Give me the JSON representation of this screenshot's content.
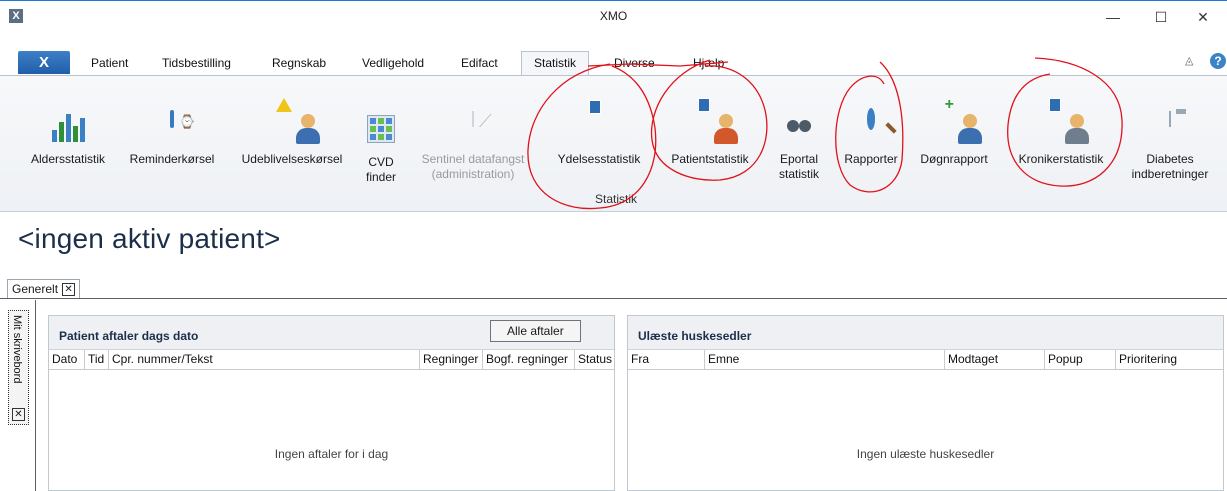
{
  "window": {
    "app_icon": "X",
    "title": "XMO",
    "minimize_glyph": "—",
    "maximize_glyph": "☐",
    "close_glyph": "✕"
  },
  "menu": {
    "app_button": "X",
    "tabs": [
      "Patient",
      "Tidsbestilling",
      "Regnskab",
      "Vedligehold",
      "Edifact",
      "Statistik",
      "Diverse",
      "Hjælp"
    ],
    "active_tab": "Statistik",
    "collapse_glyph": "◬",
    "help_glyph": "?"
  },
  "ribbon": {
    "buttons": [
      {
        "label": "Aldersstatistik",
        "icon": "bar-chart-icon",
        "enabled": true
      },
      {
        "label": "Reminderkørsel",
        "icon": "clock-icon",
        "enabled": true
      },
      {
        "label": "Udeblivelseskørsel",
        "icon": "person-warning-icon",
        "enabled": true
      },
      {
        "label": "CVD finder",
        "icon": "grid-icon",
        "enabled": true
      },
      {
        "label": "Sentinel datafangst (administration)",
        "icon": "chart-disabled-icon",
        "enabled": false
      },
      {
        "label": "Ydelsesstatistik",
        "icon": "sheet-calculator-icon",
        "enabled": true
      },
      {
        "label": "Patientstatistik",
        "icon": "people-calculator-icon",
        "enabled": true
      },
      {
        "label": "Eportal statistik",
        "icon": "binoculars-icon",
        "enabled": true
      },
      {
        "label": "Rapporter",
        "icon": "magnifier-icon",
        "enabled": true
      },
      {
        "label": "Døgnrapport",
        "icon": "person-add-icon",
        "enabled": true
      },
      {
        "label": "Kronikerstatistik",
        "icon": "person-calculator-icon",
        "enabled": true
      },
      {
        "label": "Diabetes indberetninger",
        "icon": "clipboard-icon",
        "enabled": true
      }
    ],
    "group_label": "Statistik"
  },
  "patient": {
    "title": "<ingen aktiv patient>"
  },
  "workspace": {
    "tab_label": "Generelt",
    "close_glyph": "✕",
    "side_label": "Mit skrivebord"
  },
  "appointments": {
    "title": "Patient aftaler dags dato",
    "all_button": "Alle aftaler",
    "columns": [
      "Dato",
      "Tid",
      "Cpr. nummer/Tekst",
      "Regninger",
      "Bogf. regninger",
      "Status"
    ],
    "empty_text": "Ingen aftaler for i dag"
  },
  "notes": {
    "title": "Ulæste huskesedler",
    "columns": [
      "Fra",
      "Emne",
      "Modtaget",
      "Popup",
      "Prioritering"
    ],
    "empty_text": "Ingen ulæste huskesedler"
  },
  "colors": {
    "accent": "#1f5fa9",
    "annotation": "#e0121b"
  }
}
